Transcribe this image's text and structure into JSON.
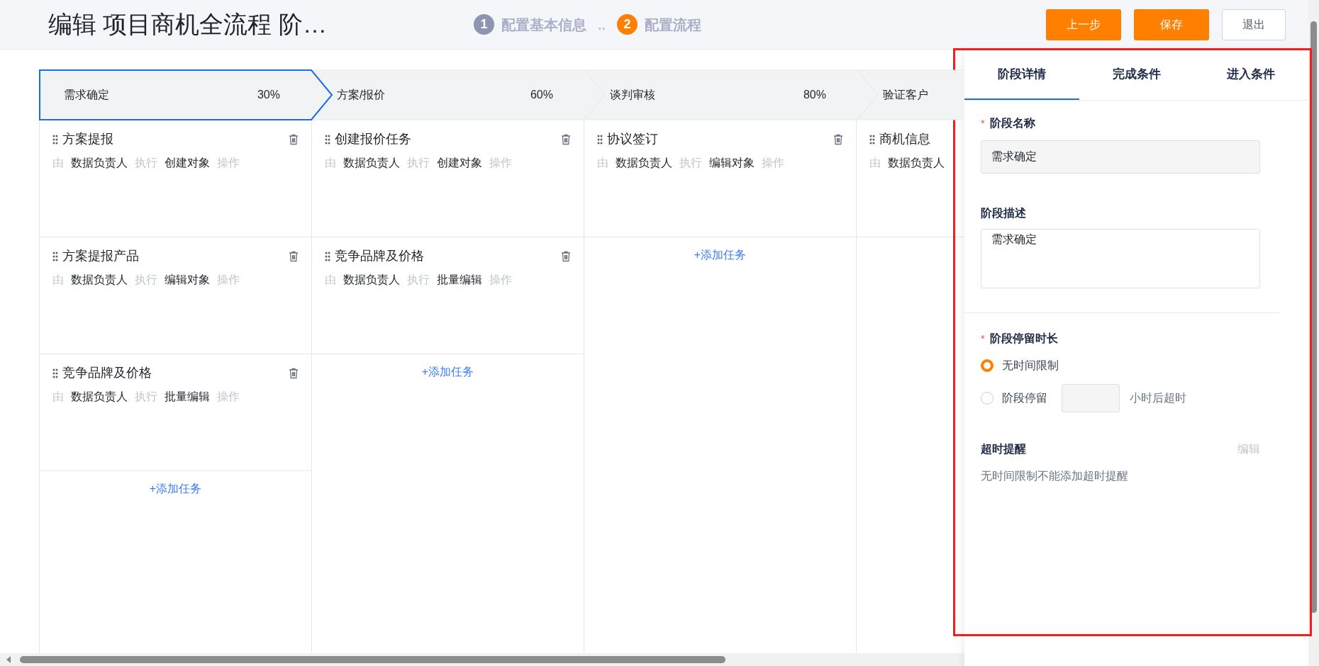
{
  "header": {
    "title": "编辑 项目商机全流程 阶…",
    "steps": [
      {
        "number": "1",
        "label": "配置基本信息",
        "selected": false
      },
      {
        "number": "2",
        "label": "配置流程",
        "selected": true
      }
    ],
    "step_separator": "..",
    "buttons": [
      {
        "label": "上一步",
        "kind": "primary"
      },
      {
        "label": "保存",
        "kind": "primary"
      },
      {
        "label": "退出",
        "kind": "default"
      }
    ]
  },
  "stages": [
    {
      "name": "需求确定",
      "percent": "30%",
      "selected": true,
      "tasks": [
        {
          "title": "方案提报",
          "by": "由",
          "owner": "数据负责人",
          "exec": "执行",
          "action": "创建对象",
          "op": "操作",
          "deletable": true
        },
        {
          "title": "方案提报产品",
          "by": "由",
          "owner": "数据负责人",
          "exec": "执行",
          "action": "编辑对象",
          "op": "操作",
          "deletable": true
        },
        {
          "title": "竞争品牌及价格",
          "by": "由",
          "owner": "数据负责人",
          "exec": "执行",
          "action": "批量编辑",
          "op": "操作",
          "deletable": true
        }
      ],
      "add_label": "+添加任务"
    },
    {
      "name": "方案/报价",
      "percent": "60%",
      "selected": false,
      "tasks": [
        {
          "title": "创建报价任务",
          "by": "由",
          "owner": "数据负责人",
          "exec": "执行",
          "action": "创建对象",
          "op": "操作",
          "deletable": true
        },
        {
          "title": "竞争品牌及价格",
          "by": "由",
          "owner": "数据负责人",
          "exec": "执行",
          "action": "批量编辑",
          "op": "操作",
          "deletable": true
        }
      ],
      "add_label": "+添加任务"
    },
    {
      "name": "谈判审核",
      "percent": "80%",
      "selected": false,
      "tasks": [
        {
          "title": "协议签订",
          "by": "由",
          "owner": "数据负责人",
          "exec": "执行",
          "action": "编辑对象",
          "op": "操作",
          "deletable": true
        }
      ],
      "add_label": "+添加任务"
    },
    {
      "name": "验证客户",
      "selected": false,
      "tasks": [
        {
          "title": "商机信息",
          "by": "由",
          "owner": "数据负责人",
          "deletable": false
        }
      ]
    }
  ],
  "panel": {
    "tabs": [
      {
        "label": "阶段详情",
        "selected": true
      },
      {
        "label": "完成条件",
        "selected": false
      },
      {
        "label": "进入条件",
        "selected": false
      }
    ],
    "name_field": {
      "label": "阶段名称",
      "required_mark": "*",
      "value": "需求确定"
    },
    "description_field": {
      "label": "阶段描述",
      "value": "需求确定"
    },
    "duration": {
      "label": "阶段停留时长",
      "required_mark": "*",
      "options": [
        {
          "label": "无时间限制",
          "selected": true
        },
        {
          "label": "阶段停留",
          "selected": false
        }
      ],
      "suffix": "小时后超时"
    },
    "timeout": {
      "label": "超时提醒",
      "edit": "编辑",
      "note": "无时间限制不能添加超时提醒"
    }
  }
}
